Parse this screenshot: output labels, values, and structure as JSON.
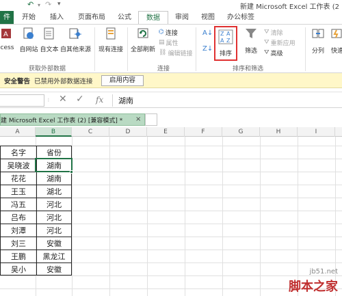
{
  "titlebar": {
    "title": "新建 Microsoft Excel 工作表 (2"
  },
  "tabs": [
    "件",
    "开始",
    "插入",
    "页面布局",
    "公式",
    "数据",
    "审阅",
    "视图",
    "办公标签"
  ],
  "ribbon": {
    "get_external": [
      "ccess",
      "自网站",
      "自文本",
      "自其他来源"
    ],
    "existing_conn": "现有连接",
    "refresh_all": "全部刷新",
    "conn_small": [
      "连接",
      "属性",
      "编辑链接"
    ],
    "sort": "排序",
    "filter": "筛选",
    "filter_small": [
      "清除",
      "重新应用",
      "高级"
    ],
    "split": "分列",
    "quick": "快速",
    "groups": [
      "获取外部数据",
      "连接",
      "排序和筛选"
    ]
  },
  "security": {
    "title": "安全警告",
    "message": "已禁用外部数据连接",
    "button": "启用内容"
  },
  "formula": {
    "fx": "fx",
    "content": "湖南"
  },
  "workbook_tab": {
    "label": "建 Microsoft Excel 工作表 (2)  [兼容模式] *",
    "close": "×"
  },
  "columns": [
    "A",
    "B",
    "C",
    "D",
    "E",
    "F",
    "G",
    "H",
    "I"
  ],
  "table": {
    "headers": [
      "名字",
      "省份"
    ],
    "rows": [
      [
        "吴晓波",
        "湖南"
      ],
      [
        "花花",
        "湖南"
      ],
      [
        "王玉",
        "湖北"
      ],
      [
        "冯五",
        "河北"
      ],
      [
        "吕布",
        "河北"
      ],
      [
        "刘潭",
        "河北"
      ],
      [
        "刘三",
        "安徽"
      ],
      [
        "王鹏",
        "黑龙江"
      ],
      [
        "吴小",
        "安徽"
      ]
    ]
  },
  "watermark": {
    "site": "jb51.net",
    "brand": "脚本之家"
  },
  "colors": {
    "excel_green": "#217346",
    "highlight_red": "#e03030"
  }
}
